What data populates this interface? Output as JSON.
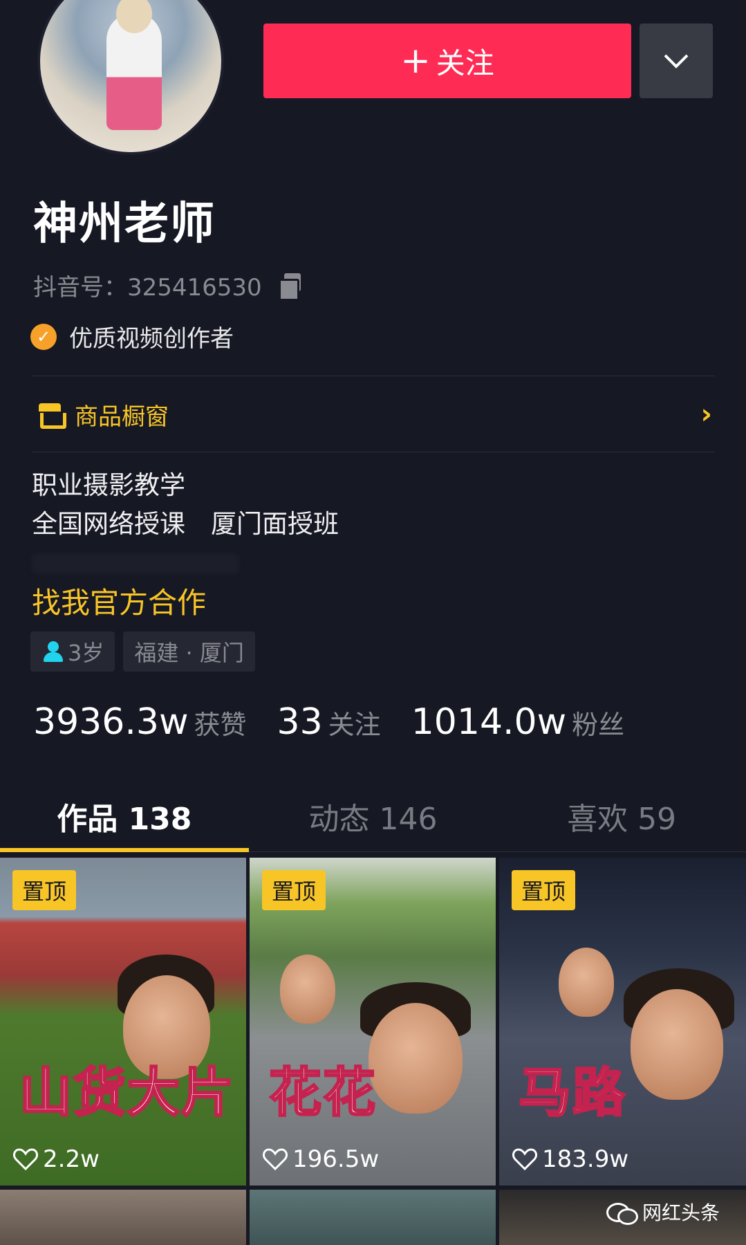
{
  "header": {
    "follow_label": "关注",
    "follow_plus": "+",
    "more_icon": "chevron-down-icon"
  },
  "profile": {
    "name": "神州老师",
    "douyin_id": "抖音号：325416530",
    "creator_badge": "优质视频创作者",
    "shop_label": "商品橱窗",
    "bio_line1": "职业摄影教学",
    "bio_line2": "全国网络授课　厦门面授班",
    "cooperation": "找我官方合作",
    "tags": [
      "3岁",
      "福建 · 厦门"
    ]
  },
  "stats": [
    {
      "value": "3936.3w",
      "label": "获赞"
    },
    {
      "value": "33",
      "label": "关注"
    },
    {
      "value": "1014.0w",
      "label": "粉丝"
    }
  ],
  "tabs": [
    {
      "label": "作品 138",
      "active": true
    },
    {
      "label": "动态 146",
      "active": false
    },
    {
      "label": "喜欢 59",
      "active": false
    }
  ],
  "videos": [
    {
      "pin": "置顶",
      "caption": "山货大片",
      "likes": "2.2w"
    },
    {
      "pin": "置顶",
      "caption": "花花",
      "likes": "196.5w"
    },
    {
      "pin": "置顶",
      "caption": "马路",
      "likes": "183.9w"
    }
  ],
  "watermark": "网红头条",
  "colors": {
    "background": "#161823",
    "accent_red": "#fe2c55",
    "accent_yellow": "#f8c527",
    "secondary_text": "#8a8b91"
  }
}
